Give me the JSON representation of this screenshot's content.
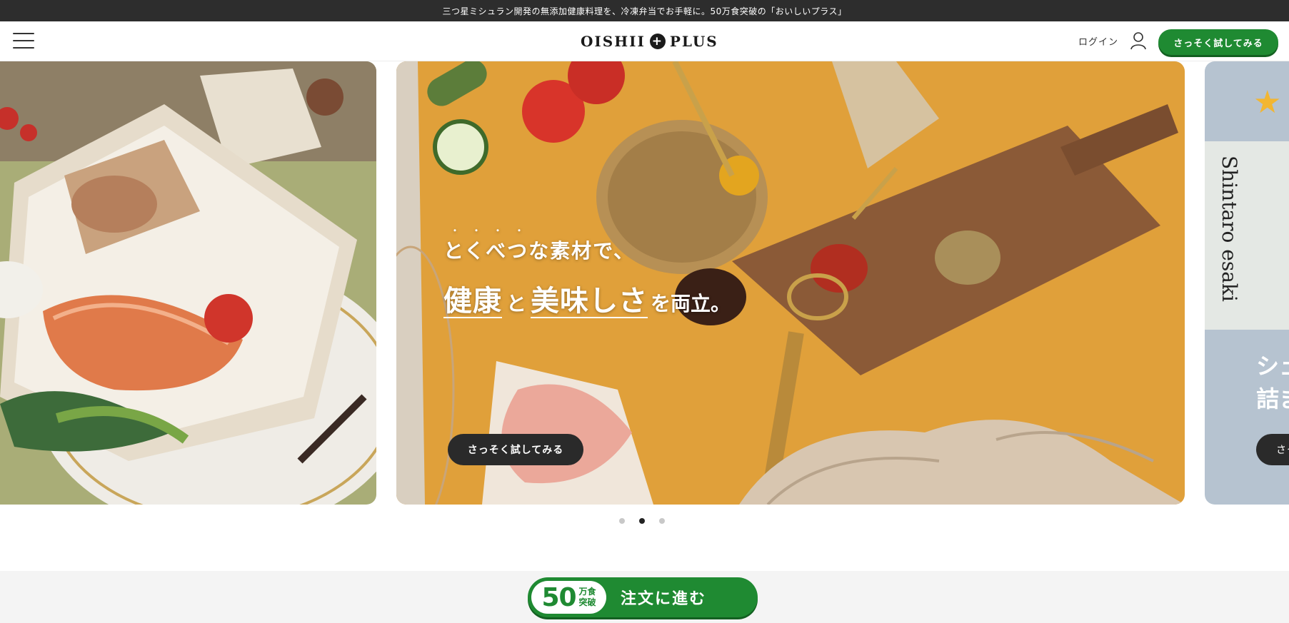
{
  "announcement": "三つ星ミシュラン開発の無添加健康料理を、冷凍弁当でお手軽に。50万食突破の「おいしいプラス」",
  "header": {
    "logo_left": "OISHII",
    "logo_mark": "+",
    "logo_right": "PLUS",
    "login_label": "ログイン",
    "cta_label": "さっそく試してみる"
  },
  "carousel": {
    "active_index": 1,
    "main_slide": {
      "emphasis_dots": "・・・・",
      "line1": "とくべつな素材で、",
      "word_health": "健康",
      "joiner": "と",
      "word_taste": "美味しさ",
      "tail": "を両立。",
      "cta_label": "さっそく試してみる"
    },
    "right_slide": {
      "chef_name": "Shintaro esaki",
      "copy_line1": "シェ",
      "copy_line2": "詰ま",
      "cta_label": "さっ"
    }
  },
  "order_bar": {
    "badge_number": "50",
    "badge_unit_top": "万食",
    "badge_unit_bottom": "突破",
    "label": "注文に進む"
  },
  "colors": {
    "brand_green": "#1f8a32",
    "topbar": "#2d2d2d",
    "orange_bg": "#e0a03a"
  }
}
